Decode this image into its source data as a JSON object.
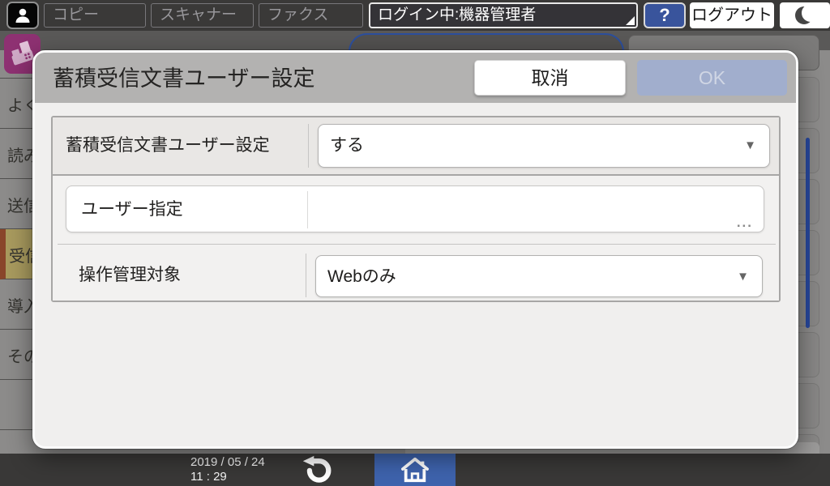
{
  "topbar": {
    "tabs": [
      {
        "label": "コピー"
      },
      {
        "label": "スキャナー"
      },
      {
        "label": "ファクス"
      }
    ],
    "login_status": "ログイン中:機器管理者",
    "help_label": "?",
    "logout_label": "ログアウト"
  },
  "background": {
    "sidebar_items": [
      {
        "label": "よく"
      },
      {
        "label": "読み"
      },
      {
        "label": "送信"
      },
      {
        "label": "受信",
        "active": true
      },
      {
        "label": "導入"
      },
      {
        "label": "その"
      }
    ]
  },
  "dialog": {
    "title": "蓄積受信文書ユーザー設定",
    "cancel_label": "取消",
    "ok_label": "OK",
    "rows": [
      {
        "label": "蓄積受信文書ユーザー設定",
        "value": "する",
        "type": "dropdown"
      },
      {
        "label": "ユーザー指定",
        "value": "",
        "type": "picker"
      },
      {
        "label": "操作管理対象",
        "value": "Webのみ",
        "type": "dropdown"
      }
    ]
  },
  "bottombar": {
    "date": "2019 / 05 / 24",
    "time": "11 : 29"
  },
  "icons": {
    "dropdown_arrow": "▼",
    "ellipsis": "..."
  },
  "colors": {
    "accent_blue": "#3e63ad",
    "help_blue": "#39549c",
    "scrollbar_blue": "#27479b",
    "fax_magenta": "#8e3172",
    "ok_disabled": "#a1aecd",
    "header_gray": "#b3b2b1",
    "highlight_olive": "#a89a5e",
    "highlight_rust": "#89452a"
  }
}
